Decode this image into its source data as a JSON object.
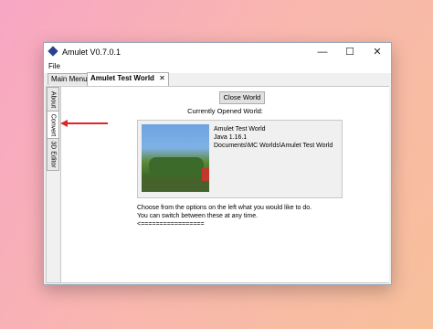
{
  "window": {
    "title": "Amulet V0.7.0.1",
    "controls": {
      "minimize": "—",
      "maximize": "☐",
      "close": "✕"
    }
  },
  "menu": {
    "file": "File"
  },
  "tabs": [
    {
      "label": "Main Menu"
    },
    {
      "label": "Amulet Test World",
      "close": "✕"
    }
  ],
  "sidebar": {
    "items": [
      {
        "label": "About"
      },
      {
        "label": "Convert"
      },
      {
        "label": "3D Editor"
      }
    ]
  },
  "main": {
    "close_world_label": "Close World",
    "current_label": "Currently Opened World:",
    "world": {
      "name": "Amulet Test World",
      "edition": "Java 1.16.1",
      "path": "Documents\\MC Worlds\\Amulet Test World"
    },
    "hint_lines": [
      "Choose from the options on the left what you would like to do.",
      "You can switch between these at any time.",
      "<================="
    ]
  },
  "colors": {
    "arrow": "#e0262a",
    "app_icon": "#2a3f8f"
  }
}
